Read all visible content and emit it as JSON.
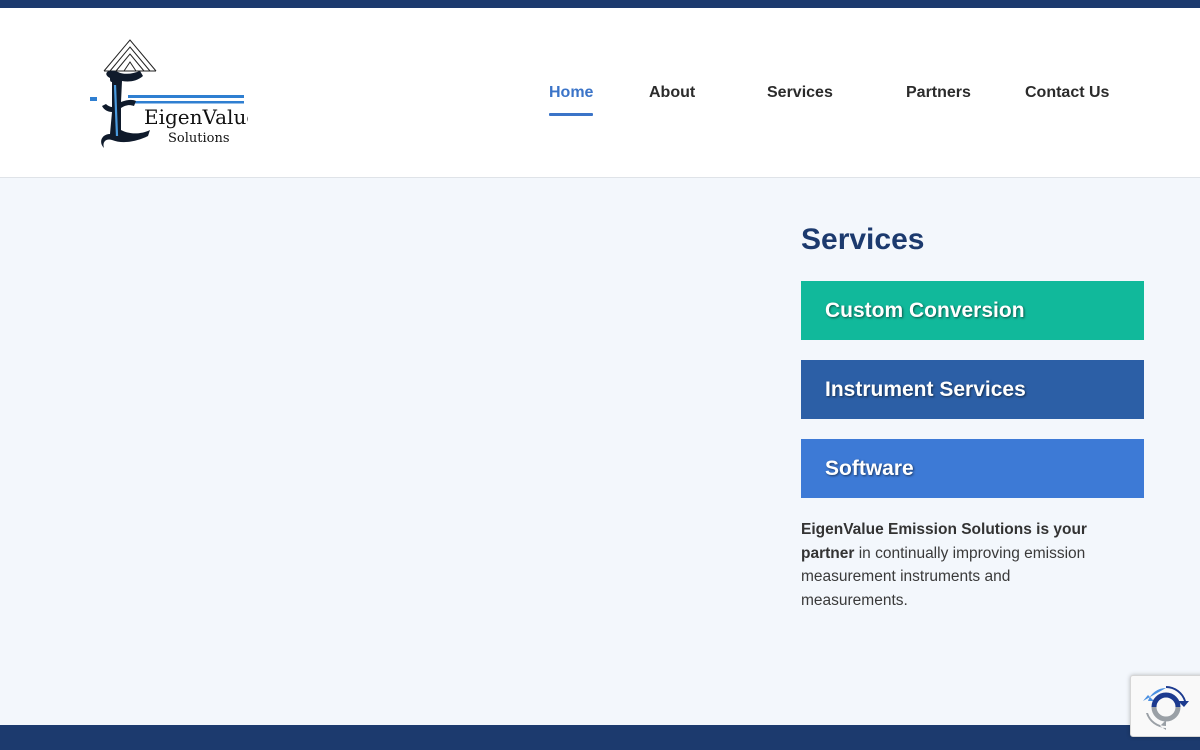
{
  "brand": {
    "logo_line1": "EigenValue",
    "logo_line2": "Solutions",
    "accent_color": "#3b74c8",
    "dark_color": "#1c3a6e"
  },
  "nav": {
    "items": [
      {
        "label": "Home",
        "active": true
      },
      {
        "label": "About",
        "active": false
      },
      {
        "label": "Services",
        "active": false
      },
      {
        "label": "Partners",
        "active": false
      },
      {
        "label": "Contact Us",
        "active": false
      }
    ]
  },
  "services": {
    "title": "Services",
    "buttons": [
      {
        "label": "Custom Conversion",
        "color": "#11b99b"
      },
      {
        "label": "Instrument Services",
        "color": "#2c5fa6"
      },
      {
        "label": "Software",
        "color": "#3d7ad6"
      }
    ],
    "description_bold": "EigenValue Emission Solutions is your partner",
    "description_rest": " in continually improving emission measurement instruments and measurements."
  },
  "recaptcha": {
    "icon": "recaptcha-icon"
  }
}
